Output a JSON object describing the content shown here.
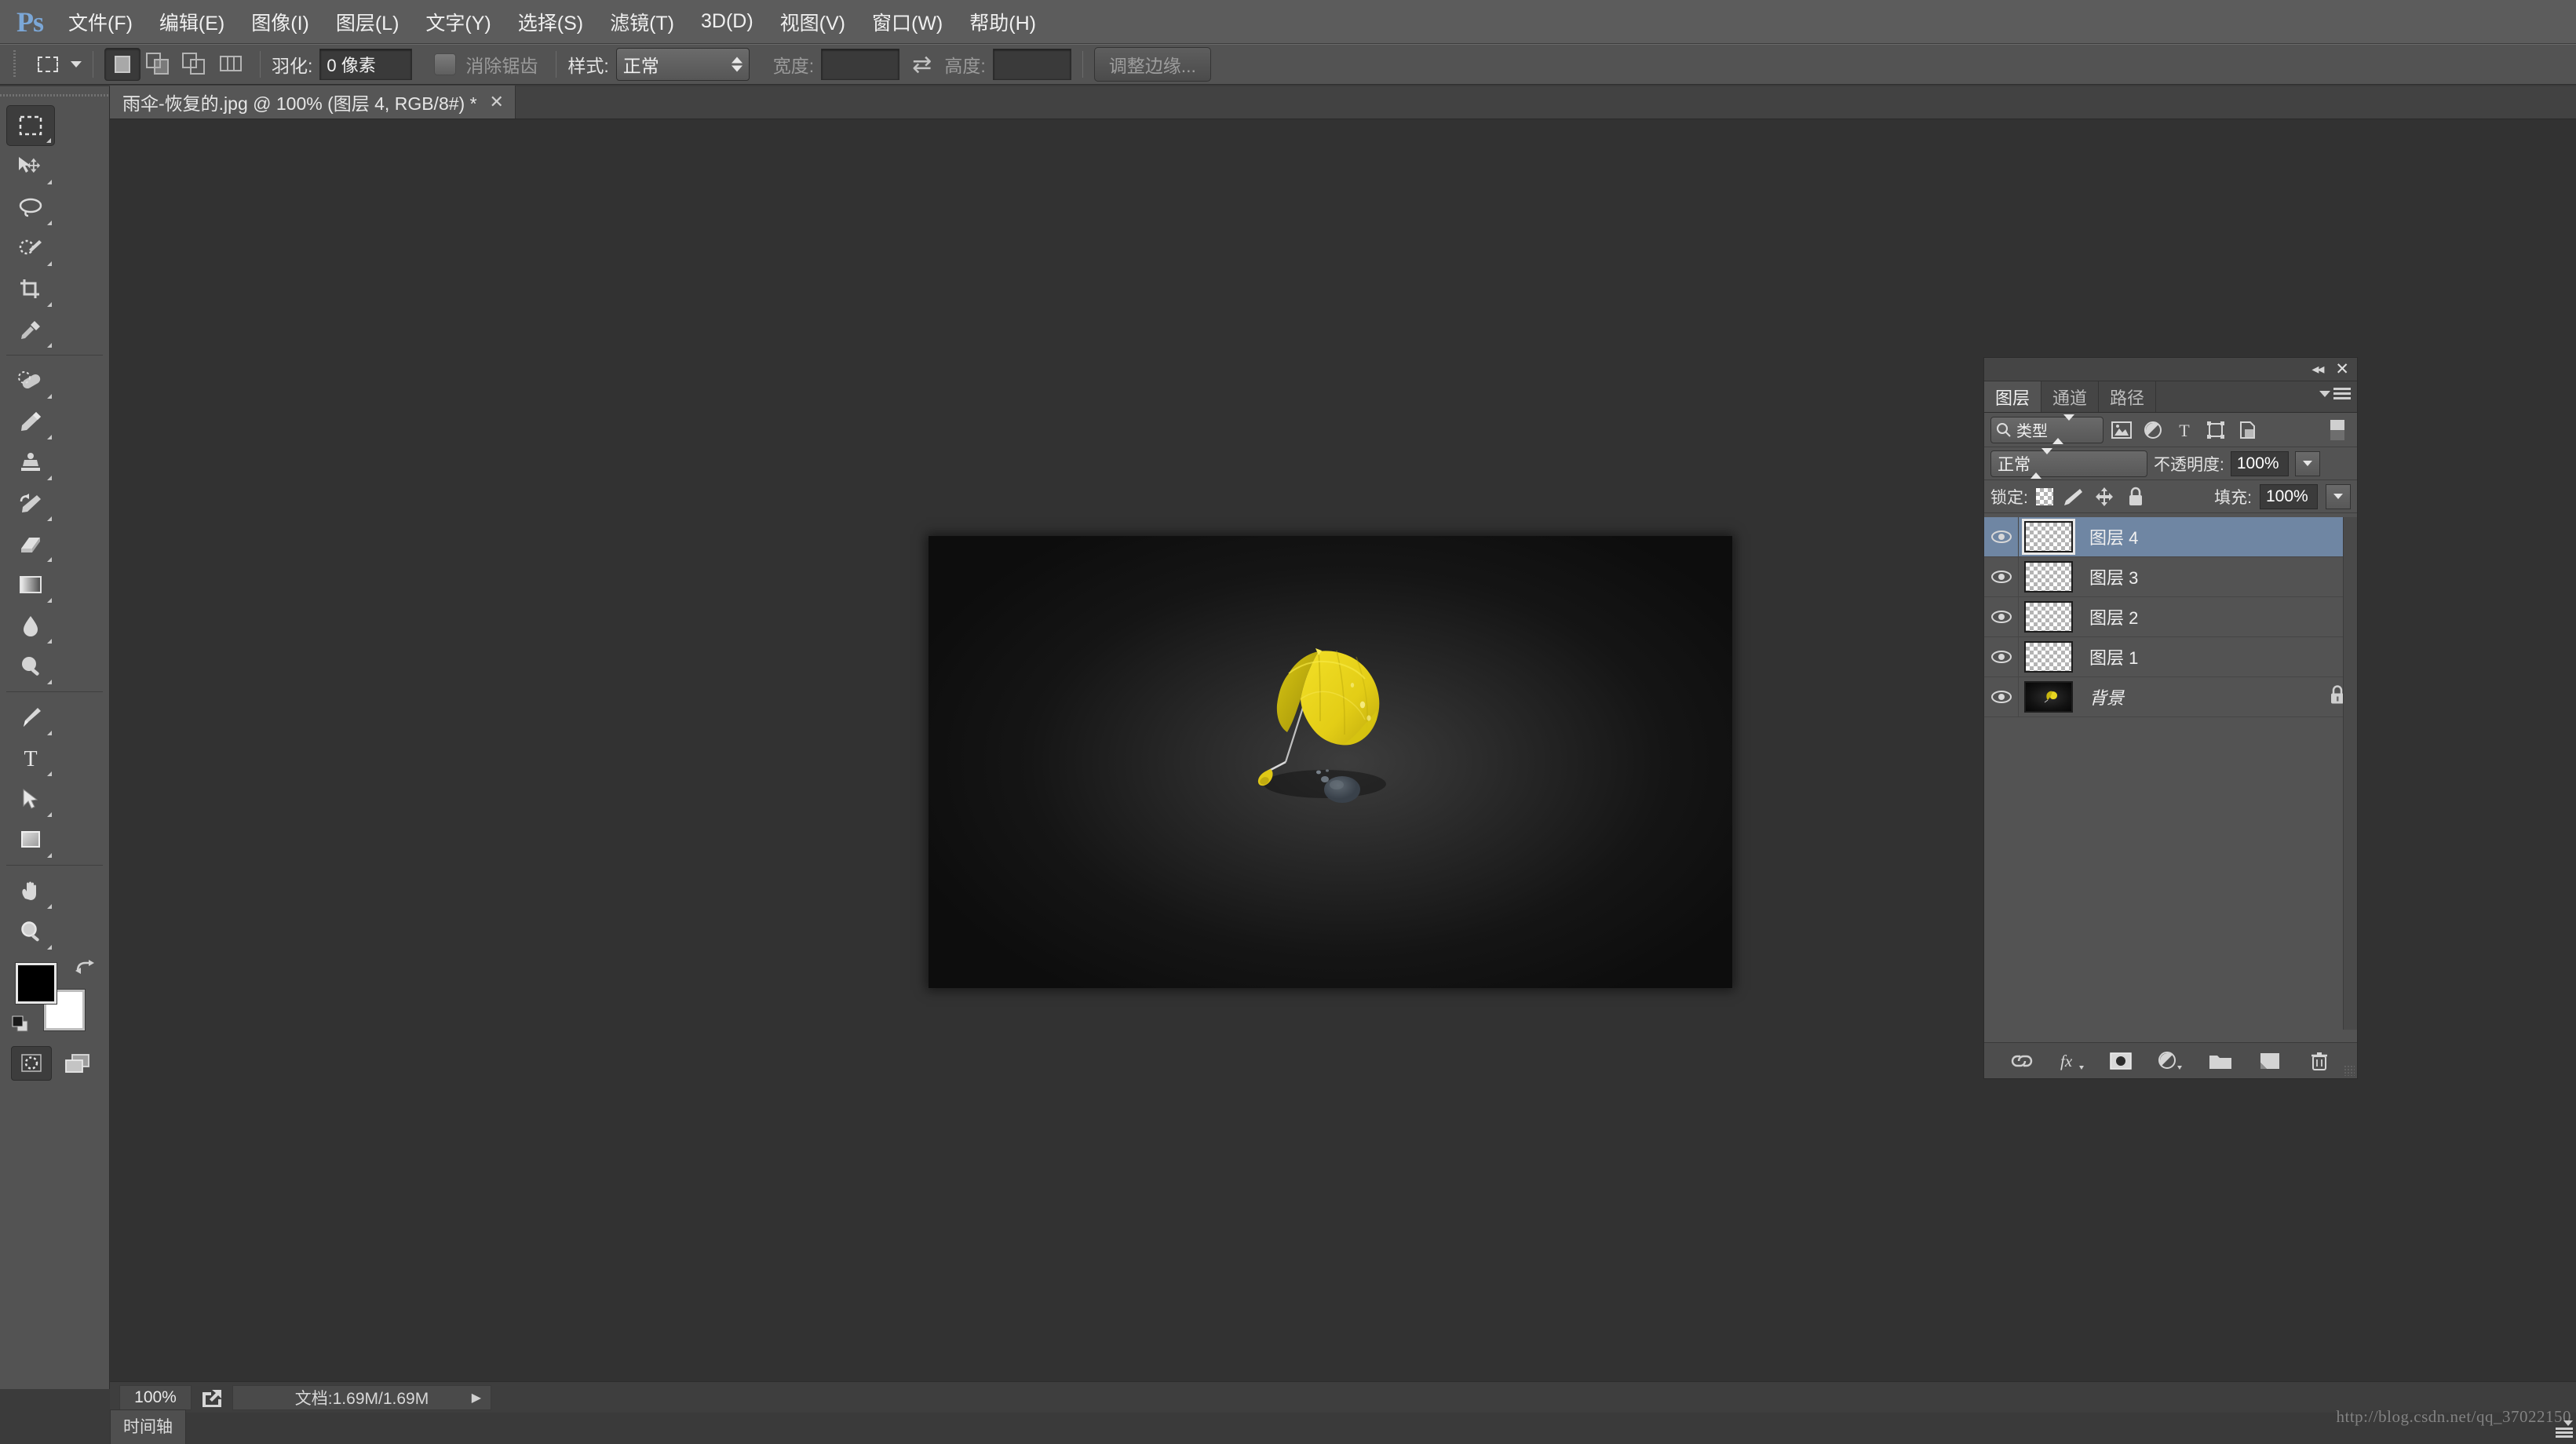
{
  "app": {
    "logo": "Ps",
    "menus": [
      {
        "label": "文件(F)",
        "name": "menu-file"
      },
      {
        "label": "编辑(E)",
        "name": "menu-edit"
      },
      {
        "label": "图像(I)",
        "name": "menu-image"
      },
      {
        "label": "图层(L)",
        "name": "menu-layer"
      },
      {
        "label": "文字(Y)",
        "name": "menu-type"
      },
      {
        "label": "选择(S)",
        "name": "menu-select"
      },
      {
        "label": "滤镜(T)",
        "name": "menu-filter"
      },
      {
        "label": "3D(D)",
        "name": "menu-3d"
      },
      {
        "label": "视图(V)",
        "name": "menu-view"
      },
      {
        "label": "窗口(W)",
        "name": "menu-window"
      },
      {
        "label": "帮助(H)",
        "name": "menu-help"
      }
    ]
  },
  "options_bar": {
    "tool_preset": "marquee-rect-icon",
    "selection_modes": [
      "new-selection",
      "add-to-selection",
      "subtract-from-selection",
      "intersect-selection"
    ],
    "active_selection_mode": 0,
    "feather_label": "羽化:",
    "feather_value": "0 像素",
    "antialias_label": "消除锯齿",
    "antialias_checked": false,
    "style_label": "样式:",
    "style_value": "正常",
    "width_label": "宽度:",
    "width_value": "",
    "height_label": "高度:",
    "height_value": "",
    "refine_edge_label": "调整边缘..."
  },
  "document_tab": {
    "title": "雨伞-恢复的.jpg @ 100% (图层 4, RGB/8#) *",
    "close": "✕"
  },
  "tools": [
    {
      "name": "marquee-tool",
      "active": true,
      "has_more": true
    },
    {
      "name": "move-tool",
      "active": false,
      "has_more": true
    },
    {
      "name": "lasso-tool",
      "active": false,
      "has_more": true
    },
    {
      "name": "quick-selection-tool",
      "active": false,
      "has_more": true
    },
    {
      "name": "crop-tool",
      "active": false,
      "has_more": true
    },
    {
      "name": "eyedropper-tool",
      "active": false,
      "has_more": true
    },
    {
      "name": "healing-brush-tool",
      "active": false,
      "has_more": true
    },
    {
      "name": "brush-tool",
      "active": false,
      "has_more": true
    },
    {
      "name": "clone-stamp-tool",
      "active": false,
      "has_more": true
    },
    {
      "name": "history-brush-tool",
      "active": false,
      "has_more": true
    },
    {
      "name": "eraser-tool",
      "active": false,
      "has_more": true
    },
    {
      "name": "gradient-tool",
      "active": false,
      "has_more": true
    },
    {
      "name": "blur-tool",
      "active": false,
      "has_more": true
    },
    {
      "name": "dodge-tool",
      "active": false,
      "has_more": true
    },
    {
      "name": "pen-tool",
      "active": false,
      "has_more": true
    },
    {
      "name": "type-tool",
      "active": false,
      "has_more": true
    },
    {
      "name": "path-selection-tool",
      "active": false,
      "has_more": true
    },
    {
      "name": "rectangle-shape-tool",
      "active": false,
      "has_more": true
    },
    {
      "name": "hand-tool",
      "active": false,
      "has_more": true
    },
    {
      "name": "zoom-tool",
      "active": false,
      "has_more": true
    }
  ],
  "colors": {
    "foreground": "#000000",
    "background": "#ffffff",
    "accent_selection": "#6f86a3",
    "panel_bg": "#535353",
    "canvas_bg": "#323232",
    "menubar_bg": "#5c5c5c",
    "umbrella_yellow": "#e9d319"
  },
  "canvas": {
    "zoom": "100%",
    "image_description": "yellow-umbrella-on-dark-background"
  },
  "layers_panel": {
    "titlebar": {
      "collapse": "◂◂",
      "close": "✕"
    },
    "tabs": [
      {
        "label": "图层",
        "active": true,
        "name": "tab-layers"
      },
      {
        "label": "通道",
        "active": false,
        "name": "tab-channels"
      },
      {
        "label": "路径",
        "active": false,
        "name": "tab-paths"
      }
    ],
    "filter": {
      "type_label": "类型",
      "icons": [
        "filter-pixel-icon",
        "filter-adjustment-icon",
        "filter-type-icon",
        "filter-shape-icon",
        "filter-smartobject-icon"
      ]
    },
    "blend_mode_label": "正常",
    "opacity_label": "不透明度:",
    "opacity_value": "100%",
    "lock_label": "锁定:",
    "lock_icons": [
      "lock-transparent-pixels-icon",
      "lock-image-pixels-icon",
      "lock-position-icon",
      "lock-all-icon"
    ],
    "fill_label": "填充:",
    "fill_value": "100%",
    "layers": [
      {
        "name": "图层 4",
        "selected": true,
        "visible": true,
        "locked": false,
        "thumb": "transparent",
        "italic": false
      },
      {
        "name": "图层 3",
        "selected": false,
        "visible": true,
        "locked": false,
        "thumb": "transparent",
        "italic": false
      },
      {
        "name": "图层 2",
        "selected": false,
        "visible": true,
        "locked": false,
        "thumb": "transparent",
        "italic": false
      },
      {
        "name": "图层 1",
        "selected": false,
        "visible": true,
        "locked": false,
        "thumb": "transparent",
        "italic": false
      },
      {
        "name": "背景",
        "selected": false,
        "visible": true,
        "locked": true,
        "thumb": "image",
        "italic": true
      }
    ],
    "footer_icons": [
      "link-layers-icon",
      "layer-style-fx-icon",
      "add-layer-mask-icon",
      "new-adjustment-layer-icon",
      "new-group-icon",
      "new-layer-icon",
      "delete-layer-icon"
    ]
  },
  "status_bar": {
    "zoom": "100%",
    "share_icon": "share-icon",
    "doc_info": "文档:1.69M/1.69M",
    "expand_arrow": "▶"
  },
  "bottom_bar": {
    "timeline_tab": "时间轴"
  },
  "watermark": "http://blog.csdn.net/qq_37022150"
}
